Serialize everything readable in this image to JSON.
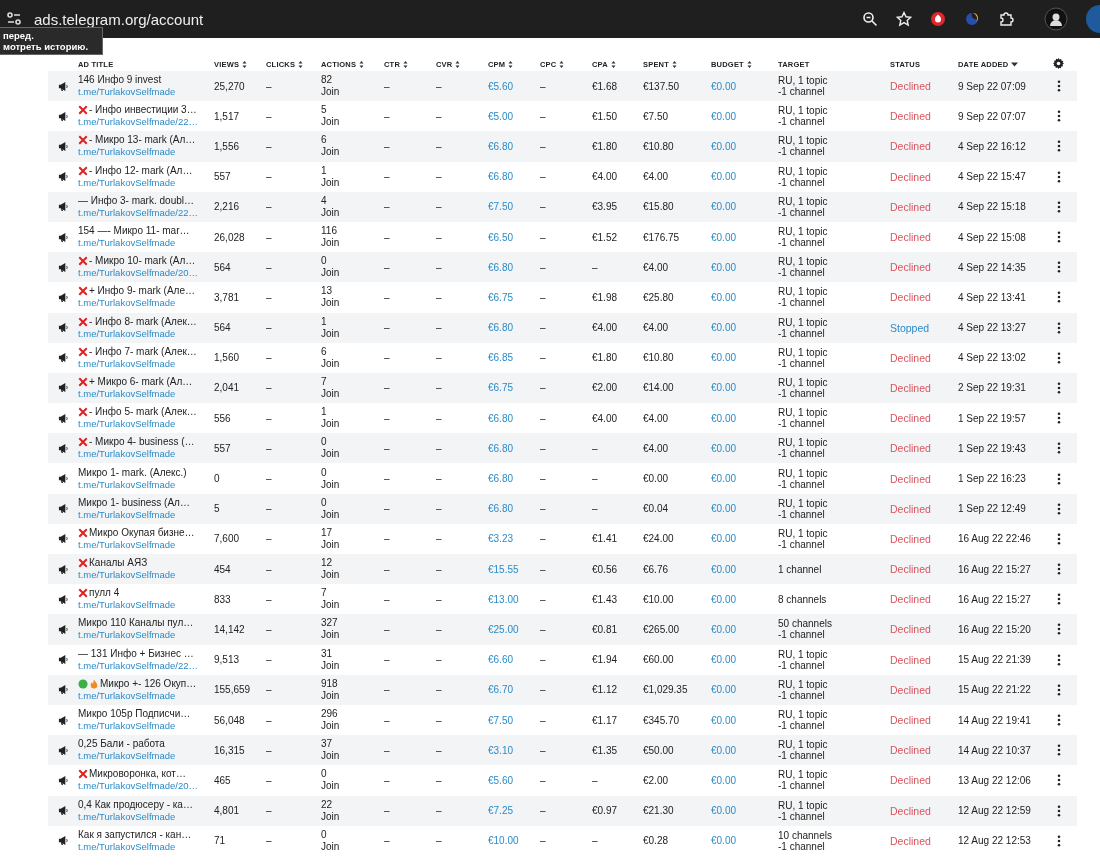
{
  "browser": {
    "address": "ads.telegram.org/account",
    "tooltip": "перед.\nмотреть историю."
  },
  "columns": [
    {
      "label": "AD TITLE",
      "sortable": false,
      "sorted": false
    },
    {
      "label": "VIEWS",
      "sortable": true,
      "sorted": false
    },
    {
      "label": "CLICKS",
      "sortable": true,
      "sorted": false
    },
    {
      "label": "ACTIONS",
      "sortable": true,
      "sorted": false
    },
    {
      "label": "CTR",
      "sortable": true,
      "sorted": false
    },
    {
      "label": "CVR",
      "sortable": true,
      "sorted": false
    },
    {
      "label": "CPM",
      "sortable": true,
      "sorted": false
    },
    {
      "label": "CPC",
      "sortable": true,
      "sorted": false
    },
    {
      "label": "CPA",
      "sortable": true,
      "sorted": false
    },
    {
      "label": "SPENT",
      "sortable": true,
      "sorted": false
    },
    {
      "label": "BUDGET",
      "sortable": true,
      "sorted": false
    },
    {
      "label": "TARGET",
      "sortable": false,
      "sorted": false
    },
    {
      "label": "STATUS",
      "sortable": false,
      "sorted": false
    },
    {
      "label": "DATE ADDED",
      "sortable": true,
      "sorted": true
    }
  ],
  "rows": [
    {
      "marks": [],
      "title": "146 Инфо 9 invest",
      "link": "t.me/TurlakovSelfmade",
      "views": "25,270",
      "clicks": "–",
      "actions": "82",
      "action_type": "Join",
      "ctr": "–",
      "cvr": "–",
      "cpm": "€5.60",
      "cpc": "–",
      "cpa": "€1.68",
      "spent": "€137.50",
      "budget": "€0.00",
      "target": "RU, 1 topic\n-1 channel",
      "status": {
        "text": "Declined",
        "color": "#d9555f"
      },
      "date": "9 Sep 22 07:09"
    },
    {
      "marks": [
        {
          "kind": "cross"
        }
      ],
      "title": "- Инфо инвестиции 3…",
      "link": "t.me/TurlakovSelfmade/22…",
      "views": "1,517",
      "clicks": "–",
      "actions": "5",
      "action_type": "Join",
      "ctr": "–",
      "cvr": "–",
      "cpm": "€5.00",
      "cpc": "–",
      "cpa": "€1.50",
      "spent": "€7.50",
      "budget": "€0.00",
      "target": "RU, 1 topic\n-1 channel",
      "status": {
        "text": "Declined",
        "color": "#d9555f"
      },
      "date": "9 Sep 22 07:07"
    },
    {
      "marks": [
        {
          "kind": "cross"
        }
      ],
      "title": "- Микро 13- mark (Ал…",
      "link": "t.me/TurlakovSelfmade",
      "views": "1,556",
      "clicks": "–",
      "actions": "6",
      "action_type": "Join",
      "ctr": "–",
      "cvr": "–",
      "cpm": "€6.80",
      "cpc": "–",
      "cpa": "€1.80",
      "spent": "€10.80",
      "budget": "€0.00",
      "target": "RU, 1 topic\n-1 channel",
      "status": {
        "text": "Declined",
        "color": "#d9555f"
      },
      "date": "4 Sep 22 16:12"
    },
    {
      "marks": [
        {
          "kind": "cross"
        }
      ],
      "title": "- Инфо 12- mark (Ал…",
      "link": "t.me/TurlakovSelfmade",
      "views": "557",
      "clicks": "–",
      "actions": "1",
      "action_type": "Join",
      "ctr": "–",
      "cvr": "–",
      "cpm": "€6.80",
      "cpc": "–",
      "cpa": "€4.00",
      "spent": "€4.00",
      "budget": "€0.00",
      "target": "RU, 1 topic\n-1 channel",
      "status": {
        "text": "Declined",
        "color": "#d9555f"
      },
      "date": "4 Sep 22 15:47"
    },
    {
      "marks": [],
      "title": "— Инфо 3- mark. doubl…",
      "link": "t.me/TurlakovSelfmade/22…",
      "views": "2,216",
      "clicks": "–",
      "actions": "4",
      "action_type": "Join",
      "ctr": "–",
      "cvr": "–",
      "cpm": "€7.50",
      "cpc": "–",
      "cpa": "€3.95",
      "spent": "€15.80",
      "budget": "€0.00",
      "target": "RU, 1 topic\n-1 channel",
      "status": {
        "text": "Declined",
        "color": "#d9555f"
      },
      "date": "4 Sep 22 15:18"
    },
    {
      "marks": [],
      "title": "154 —- Микро 11- mar…",
      "link": "t.me/TurlakovSelfmade",
      "views": "26,028",
      "clicks": "–",
      "actions": "116",
      "action_type": "Join",
      "ctr": "–",
      "cvr": "–",
      "cpm": "€6.50",
      "cpc": "–",
      "cpa": "€1.52",
      "spent": "€176.75",
      "budget": "€0.00",
      "target": "RU, 1 topic\n-1 channel",
      "status": {
        "text": "Declined",
        "color": "#d9555f"
      },
      "date": "4 Sep 22 15:08"
    },
    {
      "marks": [
        {
          "kind": "cross"
        }
      ],
      "title": "- Микро 10- mark (Ал…",
      "link": "t.me/TurlakovSelfmade/20…",
      "views": "564",
      "clicks": "–",
      "actions": "0",
      "action_type": "Join",
      "ctr": "–",
      "cvr": "–",
      "cpm": "€6.80",
      "cpc": "–",
      "cpa": "–",
      "spent": "€4.00",
      "budget": "€0.00",
      "target": "RU, 1 topic\n-1 channel",
      "status": {
        "text": "Declined",
        "color": "#d9555f"
      },
      "date": "4 Sep 22 14:35"
    },
    {
      "marks": [
        {
          "kind": "cross"
        }
      ],
      "title": "+ Инфо 9- mark (Але…",
      "link": "t.me/TurlakovSelfmade",
      "views": "3,781",
      "clicks": "–",
      "actions": "13",
      "action_type": "Join",
      "ctr": "–",
      "cvr": "–",
      "cpm": "€6.75",
      "cpc": "–",
      "cpa": "€1.98",
      "spent": "€25.80",
      "budget": "€0.00",
      "target": "RU, 1 topic\n-1 channel",
      "status": {
        "text": "Declined",
        "color": "#d9555f"
      },
      "date": "4 Sep 22 13:41"
    },
    {
      "marks": [
        {
          "kind": "cross"
        }
      ],
      "title": "- Инфо 8- mark (Алек…",
      "link": "t.me/TurlakovSelfmade",
      "views": "564",
      "clicks": "–",
      "actions": "1",
      "action_type": "Join",
      "ctr": "–",
      "cvr": "–",
      "cpm": "€6.80",
      "cpc": "–",
      "cpa": "€4.00",
      "spent": "€4.00",
      "budget": "€0.00",
      "target": "RU, 1 topic\n-1 channel",
      "status": {
        "text": "Stopped",
        "color": "#2a8bc8"
      },
      "date": "4 Sep 22 13:27"
    },
    {
      "marks": [
        {
          "kind": "cross"
        }
      ],
      "title": "- Инфо 7- mark (Алек…",
      "link": "t.me/TurlakovSelfmade",
      "views": "1,560",
      "clicks": "–",
      "actions": "6",
      "action_type": "Join",
      "ctr": "–",
      "cvr": "–",
      "cpm": "€6.85",
      "cpc": "–",
      "cpa": "€1.80",
      "spent": "€10.80",
      "budget": "€0.00",
      "target": "RU, 1 topic\n-1 channel",
      "status": {
        "text": "Declined",
        "color": "#d9555f"
      },
      "date": "4 Sep 22 13:02"
    },
    {
      "marks": [
        {
          "kind": "cross"
        }
      ],
      "title": "+ Микро 6- mark (Ал…",
      "link": "t.me/TurlakovSelfmade",
      "views": "2,041",
      "clicks": "–",
      "actions": "7",
      "action_type": "Join",
      "ctr": "–",
      "cvr": "–",
      "cpm": "€6.75",
      "cpc": "–",
      "cpa": "€2.00",
      "spent": "€14.00",
      "budget": "€0.00",
      "target": "RU, 1 topic\n-1 channel",
      "status": {
        "text": "Declined",
        "color": "#d9555f"
      },
      "date": "2 Sep 22 19:31"
    },
    {
      "marks": [
        {
          "kind": "cross"
        }
      ],
      "title": "- Инфо 5- mark (Алек…",
      "link": "t.me/TurlakovSelfmade",
      "views": "556",
      "clicks": "–",
      "actions": "1",
      "action_type": "Join",
      "ctr": "–",
      "cvr": "–",
      "cpm": "€6.80",
      "cpc": "–",
      "cpa": "€4.00",
      "spent": "€4.00",
      "budget": "€0.00",
      "target": "RU, 1 topic\n-1 channel",
      "status": {
        "text": "Declined",
        "color": "#d9555f"
      },
      "date": "1 Sep 22 19:57"
    },
    {
      "marks": [
        {
          "kind": "cross"
        }
      ],
      "title": "- Микро 4- business (…",
      "link": "t.me/TurlakovSelfmade",
      "views": "557",
      "clicks": "–",
      "actions": "0",
      "action_type": "Join",
      "ctr": "–",
      "cvr": "–",
      "cpm": "€6.80",
      "cpc": "–",
      "cpa": "–",
      "spent": "€4.00",
      "budget": "€0.00",
      "target": "RU, 1 topic\n-1 channel",
      "status": {
        "text": "Declined",
        "color": "#d9555f"
      },
      "date": "1 Sep 22 19:43"
    },
    {
      "marks": [],
      "title": "Микро 1- mark. (Алекс.)",
      "link": "t.me/TurlakovSelfmade",
      "views": "0",
      "clicks": "–",
      "actions": "0",
      "action_type": "Join",
      "ctr": "–",
      "cvr": "–",
      "cpm": "€6.80",
      "cpc": "–",
      "cpa": "–",
      "spent": "€0.00",
      "budget": "€0.00",
      "target": "RU, 1 topic\n-1 channel",
      "status": {
        "text": "Declined",
        "color": "#d9555f"
      },
      "date": "1 Sep 22 16:23"
    },
    {
      "marks": [],
      "title": "Микро 1- business (Ал…",
      "link": "t.me/TurlakovSelfmade",
      "views": "5",
      "clicks": "–",
      "actions": "0",
      "action_type": "Join",
      "ctr": "–",
      "cvr": "–",
      "cpm": "€6.80",
      "cpc": "–",
      "cpa": "–",
      "spent": "€0.04",
      "budget": "€0.00",
      "target": "RU, 1 topic\n-1 channel",
      "status": {
        "text": "Declined",
        "color": "#d9555f"
      },
      "date": "1 Sep 22 12:49"
    },
    {
      "marks": [
        {
          "kind": "cross"
        }
      ],
      "title": "Микро Окупая бизне…",
      "link": "t.me/TurlakovSelfmade",
      "views": "7,600",
      "clicks": "–",
      "actions": "17",
      "action_type": "Join",
      "ctr": "–",
      "cvr": "–",
      "cpm": "€3.23",
      "cpc": "–",
      "cpa": "€1.41",
      "spent": "€24.00",
      "budget": "€0.00",
      "target": "RU, 1 topic\n-1 channel",
      "status": {
        "text": "Declined",
        "color": "#d9555f"
      },
      "date": "16 Aug 22 22:46"
    },
    {
      "marks": [
        {
          "kind": "cross"
        }
      ],
      "title": "Каналы АЯЗ",
      "link": "t.me/TurlakovSelfmade",
      "views": "454",
      "clicks": "–",
      "actions": "12",
      "action_type": "Join",
      "ctr": "–",
      "cvr": "–",
      "cpm": "€15.55",
      "cpc": "–",
      "cpa": "€0.56",
      "spent": "€6.76",
      "budget": "€0.00",
      "target": "1 channel",
      "status": {
        "text": "Declined",
        "color": "#d9555f"
      },
      "date": "16 Aug 22 15:27"
    },
    {
      "marks": [
        {
          "kind": "cross"
        }
      ],
      "title": "пулл 4",
      "link": "t.me/TurlakovSelfmade",
      "views": "833",
      "clicks": "–",
      "actions": "7",
      "action_type": "Join",
      "ctr": "–",
      "cvr": "–",
      "cpm": "€13.00",
      "cpc": "–",
      "cpa": "€1.43",
      "spent": "€10.00",
      "budget": "€0.00",
      "target": "8 channels",
      "status": {
        "text": "Declined",
        "color": "#d9555f"
      },
      "date": "16 Aug 22 15:27"
    },
    {
      "marks": [],
      "title": "Микро 110 Каналы пул…",
      "link": "t.me/TurlakovSelfmade",
      "views": "14,142",
      "clicks": "–",
      "actions": "327",
      "action_type": "Join",
      "ctr": "–",
      "cvr": "–",
      "cpm": "€25.00",
      "cpc": "–",
      "cpa": "€0.81",
      "spent": "€265.00",
      "budget": "€0.00",
      "target": "50 channels\n-1 channel",
      "status": {
        "text": "Declined",
        "color": "#d9555f"
      },
      "date": "16 Aug 22 15:20"
    },
    {
      "marks": [],
      "title": "— 131 Инфо + Бизнес …",
      "link": "t.me/TurlakovSelfmade/22…",
      "views": "9,513",
      "clicks": "–",
      "actions": "31",
      "action_type": "Join",
      "ctr": "–",
      "cvr": "–",
      "cpm": "€6.60",
      "cpc": "–",
      "cpa": "€1.94",
      "spent": "€60.00",
      "budget": "€0.00",
      "target": "RU, 1 topic\n-1 channel",
      "status": {
        "text": "Declined",
        "color": "#d9555f"
      },
      "date": "15 Aug 22 21:39"
    },
    {
      "marks": [
        {
          "kind": "dot"
        },
        {
          "kind": "fire"
        }
      ],
      "title": "Микро +- 126 Окуп…",
      "link": "t.me/TurlakovSelfmade",
      "views": "155,659",
      "clicks": "–",
      "actions": "918",
      "action_type": "Join",
      "ctr": "–",
      "cvr": "–",
      "cpm": "€6.70",
      "cpc": "–",
      "cpa": "€1.12",
      "spent": "€1,029.35",
      "budget": "€0.00",
      "target": "RU, 1 topic\n-1 channel",
      "status": {
        "text": "Declined",
        "color": "#d9555f"
      },
      "date": "15 Aug 22 21:22"
    },
    {
      "marks": [],
      "title": "Микро 105р Подписчи…",
      "link": "t.me/TurlakovSelfmade",
      "views": "56,048",
      "clicks": "–",
      "actions": "296",
      "action_type": "Join",
      "ctr": "–",
      "cvr": "–",
      "cpm": "€7.50",
      "cpc": "–",
      "cpa": "€1.17",
      "spent": "€345.70",
      "budget": "€0.00",
      "target": "RU, 1 topic\n-1 channel",
      "status": {
        "text": "Declined",
        "color": "#d9555f"
      },
      "date": "14 Aug 22 19:41"
    },
    {
      "marks": [],
      "title": "0,25 Бали - работа",
      "link": "t.me/TurlakovSelfmade",
      "views": "16,315",
      "clicks": "–",
      "actions": "37",
      "action_type": "Join",
      "ctr": "–",
      "cvr": "–",
      "cpm": "€3.10",
      "cpc": "–",
      "cpa": "€1.35",
      "spent": "€50.00",
      "budget": "€0.00",
      "target": "RU, 1 topic\n-1 channel",
      "status": {
        "text": "Declined",
        "color": "#d9555f"
      },
      "date": "14 Aug 22 10:37"
    },
    {
      "marks": [
        {
          "kind": "cross"
        }
      ],
      "title": "Микроворонка, кот…",
      "link": "t.me/TurlakovSelfmade/20…",
      "views": "465",
      "clicks": "–",
      "actions": "0",
      "action_type": "Join",
      "ctr": "–",
      "cvr": "–",
      "cpm": "€5.60",
      "cpc": "–",
      "cpa": "–",
      "spent": "€2.00",
      "budget": "€0.00",
      "target": "RU, 1 topic\n-1 channel",
      "status": {
        "text": "Declined",
        "color": "#d9555f"
      },
      "date": "13 Aug 22 12:06"
    },
    {
      "marks": [],
      "title": "0,4 Как продюсеру - ка…",
      "link": "t.me/TurlakovSelfmade",
      "views": "4,801",
      "clicks": "–",
      "actions": "22",
      "action_type": "Join",
      "ctr": "–",
      "cvr": "–",
      "cpm": "€7.25",
      "cpc": "–",
      "cpa": "€0.97",
      "spent": "€21.30",
      "budget": "€0.00",
      "target": "RU, 1 topic\n-1 channel",
      "status": {
        "text": "Declined",
        "color": "#d9555f"
      },
      "date": "12 Aug 22 12:59"
    },
    {
      "marks": [],
      "title": "Как я запустился - кан…",
      "link": "t.me/TurlakovSelfmade",
      "views": "71",
      "clicks": "–",
      "actions": "0",
      "action_type": "Join",
      "ctr": "–",
      "cvr": "–",
      "cpm": "€10.00",
      "cpc": "–",
      "cpa": "–",
      "spent": "€0.28",
      "budget": "€0.00",
      "target": "10 channels\n-1 channel",
      "status": {
        "text": "Declined",
        "color": "#d9555f"
      },
      "date": "12 Aug 22 12:53"
    }
  ]
}
